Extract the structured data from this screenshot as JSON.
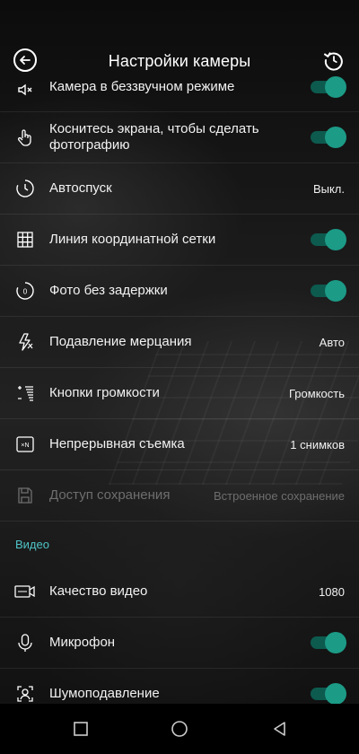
{
  "header": {
    "title": "Настройки камеры"
  },
  "rows": [
    {
      "label": "Камера в беззвучном режиме",
      "toggle": true
    },
    {
      "label": "Коснитесь экрана, чтобы сделать фотографию",
      "toggle": true
    },
    {
      "label": "Автоспуск",
      "value": "Выкл."
    },
    {
      "label": "Линия координатной сетки",
      "toggle": true
    },
    {
      "label": "Фото без задержки",
      "toggle": true
    },
    {
      "label": "Подавление мерцания",
      "value": "Авто"
    },
    {
      "label": "Кнопки громкости",
      "value": "Громкость"
    },
    {
      "label": "Непрерывная съемка",
      "value": "1 снимков"
    },
    {
      "label": "Доступ сохранения",
      "value": "Встроенное сохранение",
      "disabled": true
    }
  ],
  "section_video": "Видео",
  "video_rows": [
    {
      "label": "Качество видео",
      "value": "1080"
    },
    {
      "label": "Микрофон",
      "toggle": true
    },
    {
      "label": "Шумоподавление",
      "toggle": true
    }
  ],
  "icons": {
    "back": "back-arrow-icon",
    "reset": "reset-icon",
    "silent": "mute-speaker-icon",
    "touch": "hand-touch-icon",
    "timer": "timer-icon",
    "grid": "grid-icon",
    "zero_lag": "zero-lag-icon",
    "flicker": "flicker-icon",
    "volume": "volume-keys-icon",
    "burst": "burst-icon",
    "storage": "save-icon",
    "video_quality": "video-quality-icon",
    "mic": "microphone-icon",
    "noise": "noise-reduction-icon"
  },
  "colors": {
    "accent": "#4fc3c7",
    "toggle_on": "#1c9b87",
    "toggle_track": "#0d5a4f"
  }
}
